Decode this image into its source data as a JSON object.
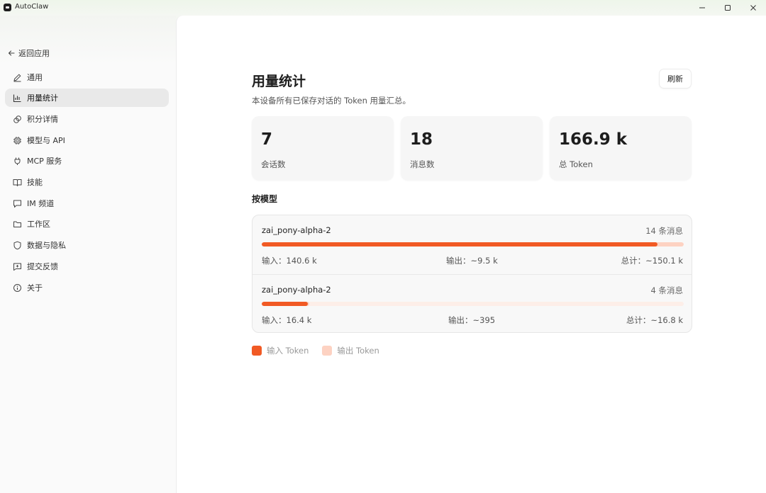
{
  "window": {
    "title": "AutoClaw",
    "controls": {
      "minimize": "minimize-icon",
      "maximize": "maximize-icon",
      "close": "close-icon"
    }
  },
  "sidebar": {
    "back_label": "返回应用",
    "items": [
      {
        "label": "通用",
        "icon": "pencil-icon",
        "active": false
      },
      {
        "label": "用量统计",
        "icon": "bar-chart-icon",
        "active": true
      },
      {
        "label": "积分详情",
        "icon": "coins-icon",
        "active": false
      },
      {
        "label": "模型与 API",
        "icon": "chip-icon",
        "active": false
      },
      {
        "label": "MCP 服务",
        "icon": "plug-icon",
        "active": false
      },
      {
        "label": "技能",
        "icon": "book-icon",
        "active": false
      },
      {
        "label": "IM 频道",
        "icon": "chat-icon",
        "active": false
      },
      {
        "label": "工作区",
        "icon": "folder-icon",
        "active": false
      },
      {
        "label": "数据与隐私",
        "icon": "shield-icon",
        "active": false
      },
      {
        "label": "提交反馈",
        "icon": "feedback-icon",
        "active": false
      },
      {
        "label": "关于",
        "icon": "info-icon",
        "active": false
      }
    ]
  },
  "main": {
    "title": "用量统计",
    "subtitle": "本设备所有已保存对话的 Token 用量汇总。",
    "refresh_label": "刷新",
    "stats": [
      {
        "value": "7",
        "label": "会话数"
      },
      {
        "value": "18",
        "label": "消息数"
      },
      {
        "value": "166.9 k",
        "label": "总 Token"
      }
    ],
    "by_model_title": "按模型",
    "models": [
      {
        "name": "zai_pony-alpha-2",
        "count": "14 条消息",
        "input": "输入：140.6 k",
        "output": "输出：~9.5 k",
        "total": "总计：~150.1 k",
        "input_fraction": 0.937,
        "output_fraction": 0.063
      },
      {
        "name": "zai_pony-alpha-2",
        "count": "4 条消息",
        "input": "输入：16.4 k",
        "output": "输出：~395",
        "total": "总计：~16.8 k",
        "input_fraction": 0.109,
        "output_fraction": 0.003
      }
    ],
    "legend": [
      {
        "label": "输入 Token",
        "color": "#f15a24"
      },
      {
        "label": "输出 Token",
        "color": "#fdd2c2"
      }
    ]
  },
  "colors": {
    "accent": "#f15a24",
    "accent_light": "#fdd2c2",
    "active_nav_bg": "#e9e9e9"
  }
}
